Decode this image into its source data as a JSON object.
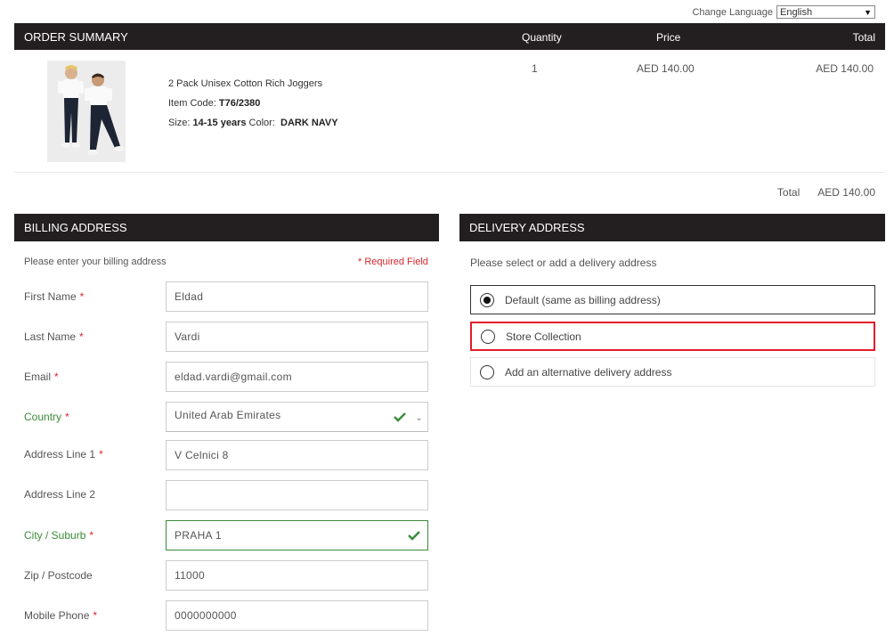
{
  "language": {
    "label": "Change Language",
    "selected": "English"
  },
  "order_summary": {
    "title": "ORDER SUMMARY",
    "col_quantity": "Quantity",
    "col_price": "Price",
    "col_total": "Total",
    "item": {
      "name": "2 Pack Unisex Cotton Rich Joggers",
      "item_code_label": "Item Code:",
      "item_code": "T76/2380",
      "size_label": "Size:",
      "size": "14-15 years",
      "color_label": "Color:",
      "color": "DARK NAVY",
      "quantity": "1",
      "price": "AED 140.00",
      "total": "AED 140.00"
    },
    "grand_total_label": "Total",
    "grand_total": "AED 140.00"
  },
  "billing": {
    "title": "BILLING ADDRESS",
    "intro": "Please enter your billing address",
    "required_note": "* Required Field",
    "fields": {
      "first_name": {
        "label": "First Name",
        "value": "Eldad"
      },
      "last_name": {
        "label": "Last Name",
        "value": "Vardi"
      },
      "email": {
        "label": "Email",
        "value": "eldad.vardi@gmail.com"
      },
      "country": {
        "label": "Country",
        "value": "United Arab Emirates"
      },
      "address1": {
        "label": "Address Line 1",
        "value": "V Celnici 8"
      },
      "address2": {
        "label": "Address Line 2",
        "value": ""
      },
      "city": {
        "label": "City / Suburb",
        "value": "PRAHA 1"
      },
      "zip": {
        "label": "Zip / Postcode",
        "value": "11000"
      },
      "phone": {
        "label": "Mobile Phone",
        "value": "0000000000"
      }
    },
    "required_mark": "*"
  },
  "delivery": {
    "title": "DELIVERY ADDRESS",
    "intro": "Please select or add a delivery address",
    "options": [
      {
        "label": "Default (same as billing address)",
        "selected": true
      },
      {
        "label": "Store Collection",
        "selected": false
      },
      {
        "label": "Add an alternative delivery address",
        "selected": false
      }
    ]
  },
  "colors": {
    "header_bg": "#231f20",
    "required_red": "#d9262e",
    "valid_green": "#3a8a3a",
    "highlight_red": "#e11d2a"
  }
}
